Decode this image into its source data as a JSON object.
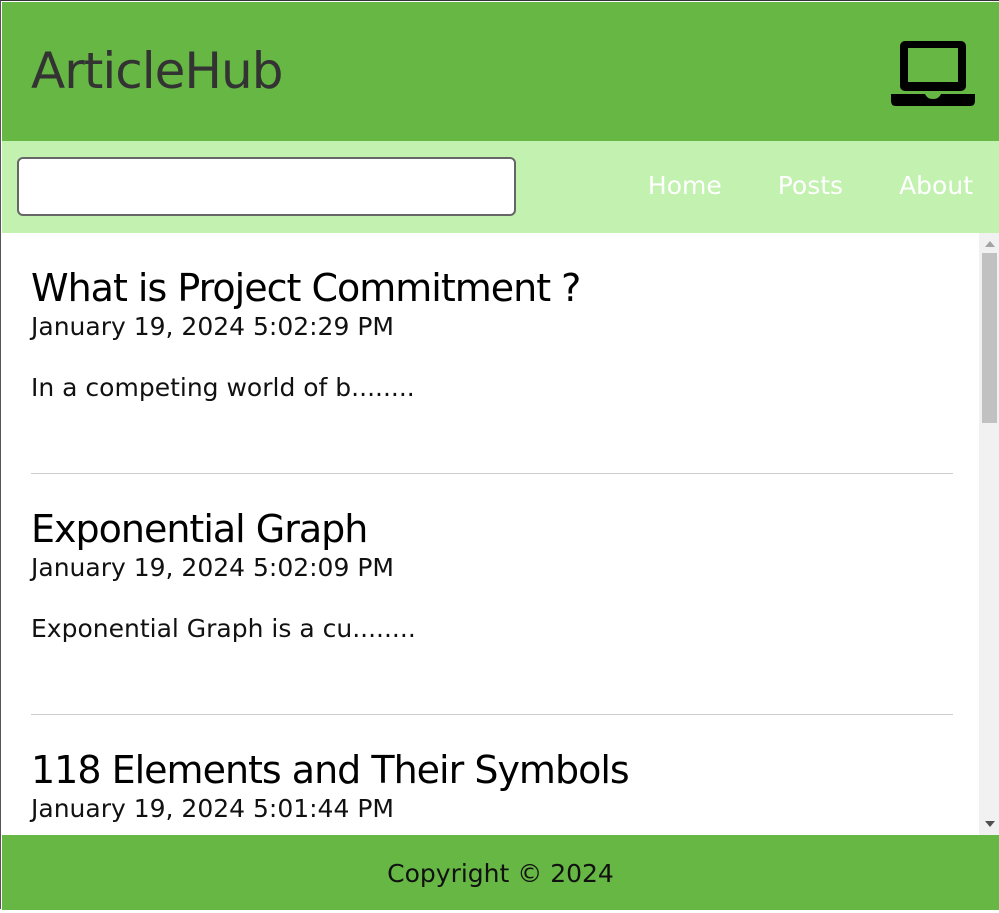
{
  "header": {
    "logo": "ArticleHub",
    "icon": "laptop-icon"
  },
  "nav": {
    "search_value": "",
    "links": [
      "Home",
      "Posts",
      "About"
    ]
  },
  "posts": [
    {
      "title": "What is Project Commitment ?",
      "date": "January 19, 2024 5:02:29 PM",
      "excerpt": "In a competing world of b........"
    },
    {
      "title": "Exponential Graph",
      "date": "January 19, 2024 5:02:09 PM",
      "excerpt": "Exponential Graph is a cu........"
    },
    {
      "title": "118 Elements and Their Symbols",
      "date": "January 19, 2024 5:01:44 PM",
      "excerpt": ""
    }
  ],
  "footer": {
    "copyright": "Copyright © 2024"
  },
  "colors": {
    "header": "#66b743",
    "nav": "#c2f1b0"
  }
}
